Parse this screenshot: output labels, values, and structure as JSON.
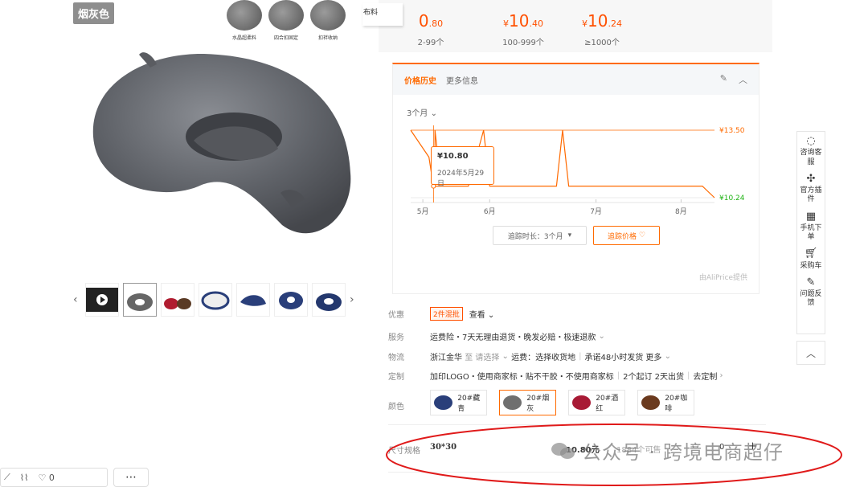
{
  "gallery": {
    "color_tag": "烟灰色",
    "features": [
      {
        "label": "水晶超柔料"
      },
      {
        "label": "四合扣固定"
      },
      {
        "label": "扣袢收纳"
      }
    ],
    "thumb_count": 8
  },
  "bottom_bar": {
    "heart_count": "0"
  },
  "price_tiers": {
    "fabric_tab": "布料",
    "tiers": [
      {
        "price_main": "0",
        "price_dec": ".80",
        "qty": "2-99个"
      },
      {
        "price_prefix": "¥",
        "price_main": "10",
        "price_dec": ".40",
        "qty": "100-999个"
      },
      {
        "price_prefix": "¥",
        "price_main": "10",
        "price_dec": ".24",
        "qty": "≥1000个"
      }
    ]
  },
  "price_history": {
    "tab_active": "价格历史",
    "tab_more": "更多信息",
    "range_label": "3个月",
    "tooltip_price": "¥10.80",
    "tooltip_date": "2024年5月29日",
    "track_duration": "追踪时长：3个月",
    "track_price": "追踪价格",
    "provider": "由AliPrice提供"
  },
  "chart_data": {
    "type": "line",
    "x_ticks": [
      "5月",
      "6月",
      "7月",
      "8月"
    ],
    "ylim": [
      10.24,
      13.5
    ],
    "max_label": "¥13.50",
    "min_label": "¥10.24",
    "series": [
      {
        "color": "#ff6a00",
        "points": [
          {
            "x": 0.0,
            "y": 13.5
          },
          {
            "x": 0.06,
            "y": 12.2
          },
          {
            "x": 0.075,
            "y": 10.8
          },
          {
            "x": 0.09,
            "y": 12.2
          },
          {
            "x": 0.08,
            "y": 13.5
          },
          {
            "x": 0.08,
            "y": 10.8
          },
          {
            "x": 0.19,
            "y": 10.8
          },
          {
            "x": 0.24,
            "y": 13.5
          },
          {
            "x": 0.26,
            "y": 10.8
          },
          {
            "x": 0.48,
            "y": 10.8
          },
          {
            "x": 0.5,
            "y": 13.5
          },
          {
            "x": 0.52,
            "y": 10.8
          },
          {
            "x": 0.96,
            "y": 10.8
          },
          {
            "x": 1.0,
            "y": 10.24
          }
        ]
      }
    ]
  },
  "info": {
    "discount_label": "优惠",
    "discount_badge": "2件混批",
    "discount_view": "查看",
    "service_label": "服务",
    "service_value": "运费险・7天无理由退货・晚发必赔・极速退款",
    "logistics_label": "物流",
    "logistics_origin": "浙江金华",
    "logistics_to": "至 请选择",
    "logistics_fee": "运费：选择收货地",
    "logistics_promise": "承诺48小时发货 更多",
    "custom_label": "定制",
    "custom_value": "加印LOGO・使用商家标・贴不干胶・不使用商家标",
    "custom_min": "2个起订 2天出货",
    "custom_go": "去定制",
    "color_label": "颜色",
    "swatches": [
      {
        "name": "20#藏青",
        "color": "#2a3f7a"
      },
      {
        "name": "20#烟灰",
        "color": "#6f6f6f"
      },
      {
        "name": "20#酒红",
        "color": "#a81a35"
      },
      {
        "name": "20#咖啡",
        "color": "#6b3a1e"
      }
    ]
  },
  "size_row": {
    "label": "尺寸规格",
    "size": "30*30",
    "price": "10.80元",
    "stock": "1884个可售",
    "qty": "0"
  },
  "watermark": {
    "text": "公众号 · 跨境电商超仔"
  },
  "sidebar": {
    "items": [
      {
        "label": "咨询客服",
        "icon": "chat-icon"
      },
      {
        "label": "官方插件",
        "icon": "puzzle-icon"
      },
      {
        "label": "手机下单",
        "icon": "qr-icon"
      },
      {
        "label": "采购车",
        "icon": "cart-icon"
      },
      {
        "label": "问题反馈",
        "icon": "edit-icon"
      }
    ]
  },
  "colors": {
    "accent": "#ff6a00",
    "price_red": "#ff5000",
    "min_green": "#21b316"
  }
}
